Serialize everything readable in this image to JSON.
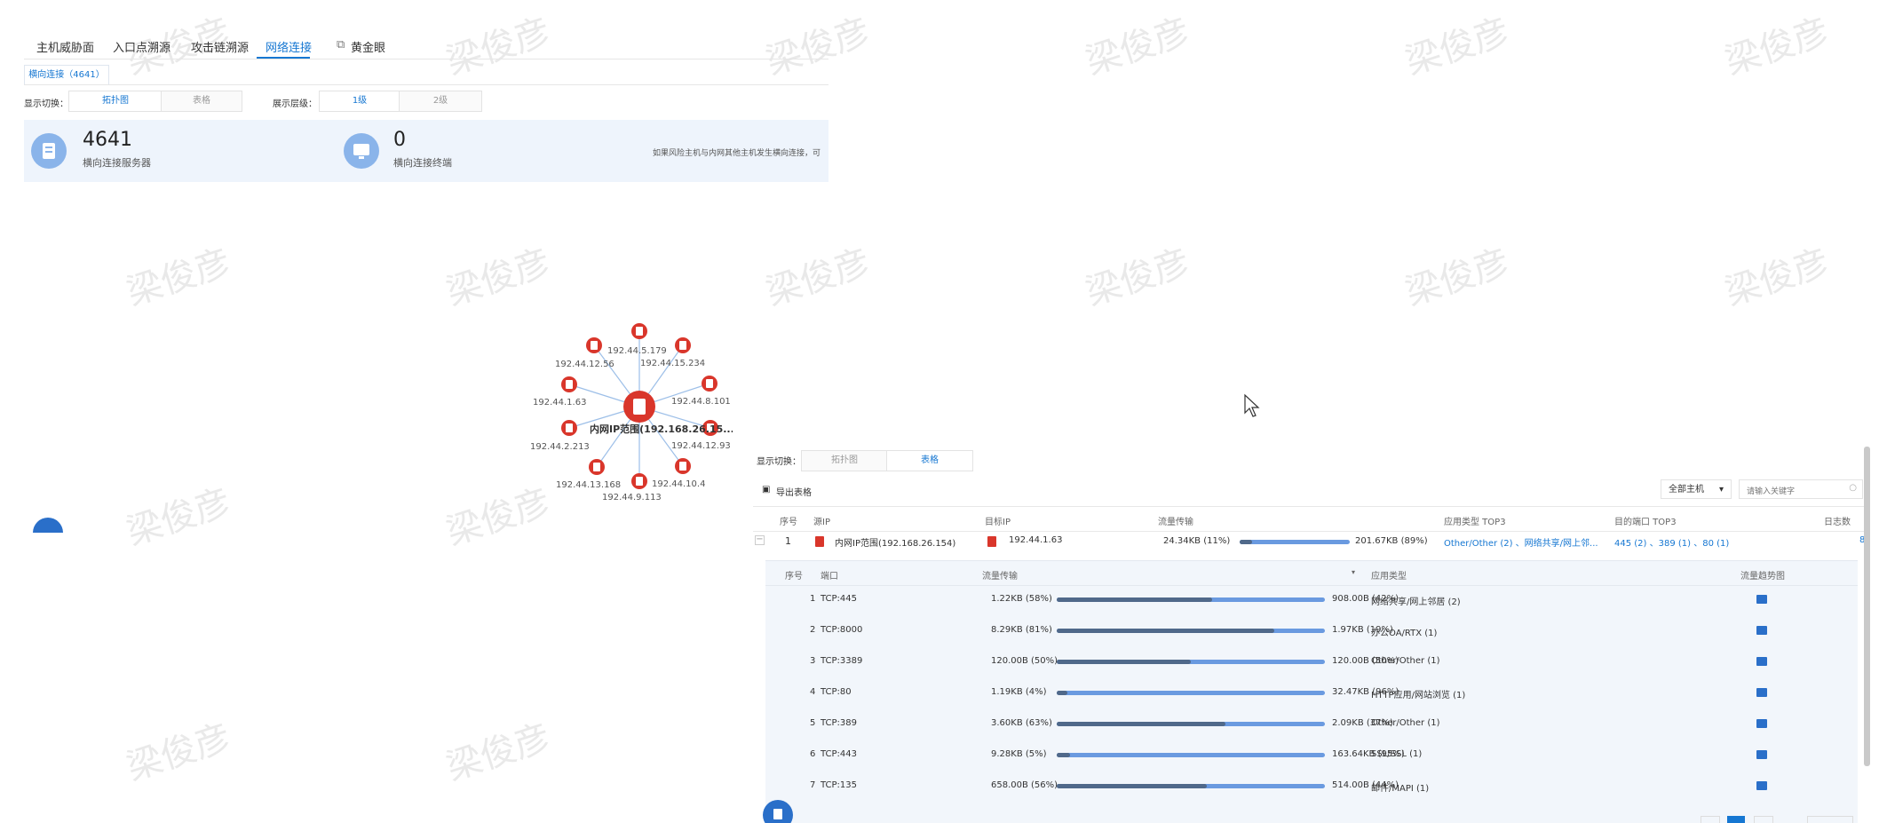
{
  "colors": {
    "accent": "#1677d2",
    "node_red": "#d9362b",
    "bar_dark": "#50698a",
    "bar_light": "#6a9ae0",
    "info_bg": "#eef4fc"
  },
  "watermark": "梁俊彦",
  "top_tabs": [
    "主机威胁面",
    "入口点溯源",
    "攻击链溯源",
    "网络连接",
    "黄金眼"
  ],
  "active_tab": "网络连接",
  "subtab_label": "横向连接（4641）",
  "display_switch": {
    "label": "显示切换：",
    "options": [
      "拓扑图",
      "表格"
    ],
    "active": "拓扑图"
  },
  "level_switch": {
    "label": "展示层级：",
    "options": [
      "1级",
      "2级"
    ],
    "active": "1级"
  },
  "stats": [
    {
      "value": "4641",
      "label": "横向连接服务器",
      "icon": "server-icon"
    },
    {
      "value": "0",
      "label": "横向连接终端",
      "icon": "monitor-icon"
    }
  ],
  "tip_text": "如果风险主机与内网其他主机发生横向连接，可",
  "topology": {
    "center_label": "内网IP范围(192.168.26.15...",
    "nodes": [
      "192.44.5.179",
      "192.44.15.234",
      "192.44.12.56",
      "192.44.8.101",
      "192.44.1.63",
      "192.44.12.93",
      "192.44.2.213",
      "192.44.10.4",
      "192.44.13.168",
      "192.44.9.113"
    ]
  },
  "table_panel": {
    "display_switch": {
      "label": "显示切换：",
      "options": [
        "拓扑图",
        "表格"
      ],
      "active": "表格"
    },
    "export_label": "导出表格",
    "host_filter": "全部主机",
    "search_placeholder": "请输入关键字",
    "columns": [
      "序号",
      "源IP",
      "目标IP",
      "流量传输",
      "应用类型 TOP3",
      "目的端口 TOP3",
      "日志数"
    ],
    "row": {
      "index": "1",
      "src": "内网IP范围(192.168.26.154)",
      "dst": "192.44.1.63",
      "left": "24.34KB (11%)",
      "right": "201.67KB (89%)",
      "left_frac": 0.11,
      "apps": "Other/Other (2) 、网络共享/网上邻...",
      "ports": "445 (2) 、389 (1) 、80 (1)",
      "logs": "8"
    },
    "sub_columns": [
      "序号",
      "端口",
      "流量传输",
      "应用类型",
      "流量趋势图"
    ],
    "sub_rows": [
      {
        "index": "1",
        "port": "TCP:445",
        "left": "1.22KB (58%)",
        "right": "908.00B (42%)",
        "left_frac": 0.58,
        "app": "网络共享/网上邻居 (2)"
      },
      {
        "index": "2",
        "port": "TCP:8000",
        "left": "8.29KB (81%)",
        "right": "1.97KB (19%)",
        "left_frac": 0.81,
        "app": "办公OA/RTX (1)"
      },
      {
        "index": "3",
        "port": "TCP:3389",
        "left": "120.00B (50%)",
        "right": "120.00B (50%)",
        "left_frac": 0.5,
        "app": "Other/Other (1)"
      },
      {
        "index": "4",
        "port": "TCP:80",
        "left": "1.19KB (4%)",
        "right": "32.47KB (96%)",
        "left_frac": 0.04,
        "app": "HTTP应用/网站浏览 (1)"
      },
      {
        "index": "5",
        "port": "TCP:389",
        "left": "3.60KB (63%)",
        "right": "2.09KB (37%)",
        "left_frac": 0.63,
        "app": "Other/Other (1)"
      },
      {
        "index": "6",
        "port": "TCP:443",
        "left": "9.28KB (5%)",
        "right": "163.64KB (95%)",
        "left_frac": 0.05,
        "app": "SSL/SSL (1)"
      },
      {
        "index": "7",
        "port": "TCP:135",
        "left": "658.00B (56%)",
        "right": "514.00B (44%)",
        "left_frac": 0.56,
        "app": "邮件/MAPI (1)"
      }
    ]
  }
}
